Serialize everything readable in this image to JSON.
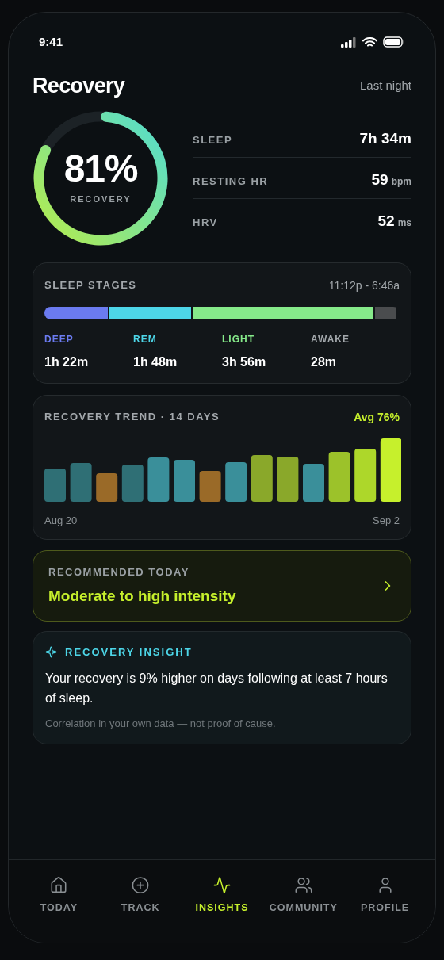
{
  "status_bar": {
    "time": "9:41"
  },
  "header": {
    "title": "Recovery",
    "period": "Last night"
  },
  "recovery": {
    "value": "81%",
    "label": "RECOVERY",
    "level": 0.81
  },
  "metrics": [
    {
      "label": "SLEEP",
      "value": "7h 34m"
    },
    {
      "label": "RESTING HR",
      "value": "59",
      "unit": "bpm"
    },
    {
      "label": "HRV",
      "value": "52",
      "unit": "ms"
    }
  ],
  "sleep_stages": {
    "title": "SLEEP STAGES",
    "range": "11:12p - 6:46a",
    "stages": [
      {
        "label": "DEEP",
        "value": "1h 22m",
        "color": "#6b7bf0"
      },
      {
        "label": "REM",
        "value": "1h 48m",
        "color": "#4dd6e8"
      },
      {
        "label": "LIGHT",
        "value": "3h 56m",
        "color": "#86ea8a"
      },
      {
        "label": "AWAKE",
        "value": "28m",
        "color": "#4a4c4e"
      }
    ]
  },
  "trend": {
    "title": "RECOVERY TREND · 14 DAYS",
    "average": "Avg 76%",
    "start": "Aug 20",
    "end": "Sep 2"
  },
  "recommendation": {
    "label": "RECOMMENDED TODAY",
    "text": "Moderate to high intensity"
  },
  "insight": {
    "title": "RECOVERY INSIGHT",
    "text": "Your recovery is 9% higher on days following at least 7 hours of sleep.",
    "note": "Correlation in your own data — not proof of cause."
  },
  "tabs": [
    {
      "label": "TODAY",
      "selected": false
    },
    {
      "label": "TRACK",
      "selected": false
    },
    {
      "label": "INSIGHTS",
      "selected": true
    },
    {
      "label": "COMMUNITY",
      "selected": false
    },
    {
      "label": "PROFILE",
      "selected": false
    }
  ]
}
